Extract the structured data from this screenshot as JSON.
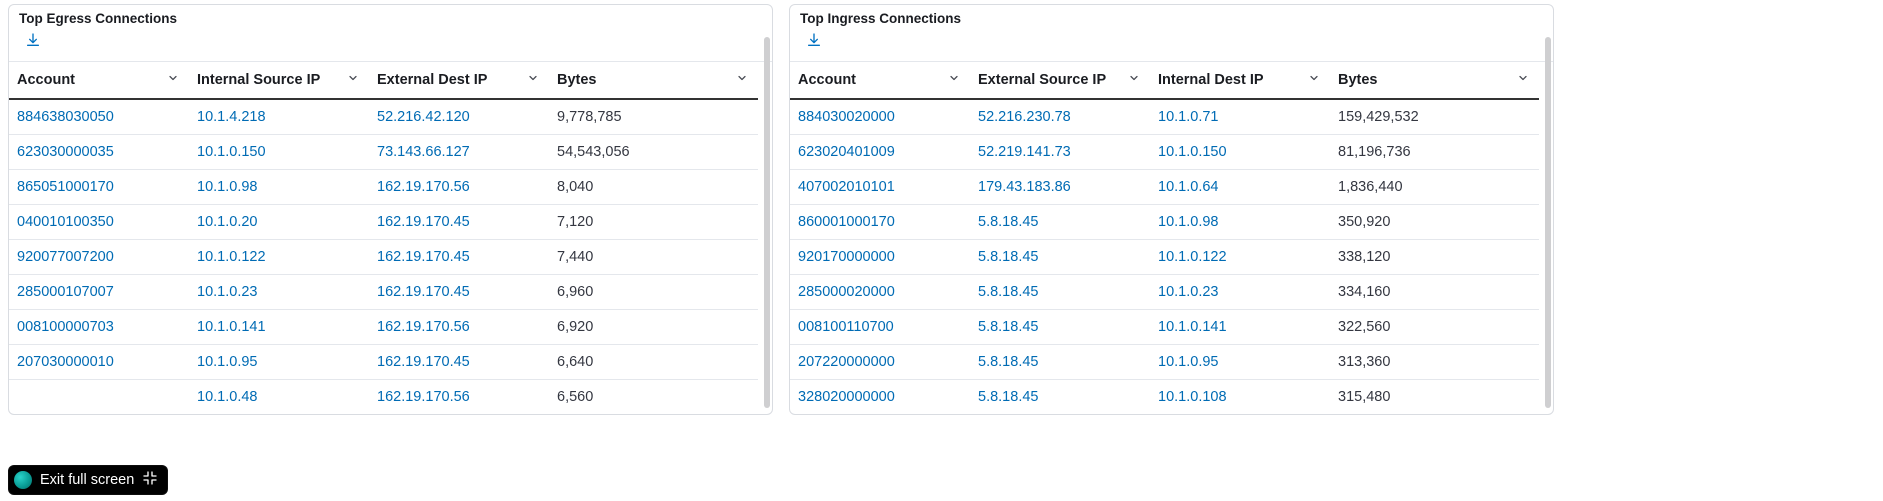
{
  "panels": [
    {
      "title": "Top Egress Connections",
      "columns": [
        "Account",
        "Internal Source IP",
        "External Dest IP",
        "Bytes"
      ],
      "link_cols": [
        0,
        1,
        2
      ],
      "rows": [
        [
          "884638030050",
          "10.1.4.218",
          "52.216.42.120",
          "9,778,785"
        ],
        [
          "623030000035",
          "10.1.0.150",
          "73.143.66.127",
          "54,543,056"
        ],
        [
          "865051000170",
          "10.1.0.98",
          "162.19.170.56",
          "8,040"
        ],
        [
          "040010100350",
          "10.1.0.20",
          "162.19.170.45",
          "7,120"
        ],
        [
          "920077007200",
          "10.1.0.122",
          "162.19.170.45",
          "7,440"
        ],
        [
          "285000107007",
          "10.1.0.23",
          "162.19.170.45",
          "6,960"
        ],
        [
          "008100000703",
          "10.1.0.141",
          "162.19.170.56",
          "6,920"
        ],
        [
          "207030000010",
          "10.1.0.95",
          "162.19.170.45",
          "6,640"
        ],
        [
          "",
          "10.1.0.48",
          "162.19.170.56",
          "6,560"
        ]
      ]
    },
    {
      "title": "Top Ingress Connections",
      "columns": [
        "Account",
        "External Source IP",
        "Internal Dest IP",
        "Bytes"
      ],
      "link_cols": [
        0,
        1,
        2
      ],
      "rows": [
        [
          "884030020000",
          "52.216.230.78",
          "10.1.0.71",
          "159,429,532"
        ],
        [
          "623020401009",
          "52.219.141.73",
          "10.1.0.150",
          "81,196,736"
        ],
        [
          "407002010101",
          "179.43.183.86",
          "10.1.0.64",
          "1,836,440"
        ],
        [
          "860001000170",
          "5.8.18.45",
          "10.1.0.98",
          "350,920"
        ],
        [
          "920170000000",
          "5.8.18.45",
          "10.1.0.122",
          "338,120"
        ],
        [
          "285000020000",
          "5.8.18.45",
          "10.1.0.23",
          "334,160"
        ],
        [
          "008100110700",
          "5.8.18.45",
          "10.1.0.141",
          "322,560"
        ],
        [
          "207220000000",
          "5.8.18.45",
          "10.1.0.95",
          "313,360"
        ],
        [
          "328020000000",
          "5.8.18.45",
          "10.1.0.108",
          "315,480"
        ]
      ]
    }
  ],
  "exit_full_screen_label": "Exit full screen"
}
